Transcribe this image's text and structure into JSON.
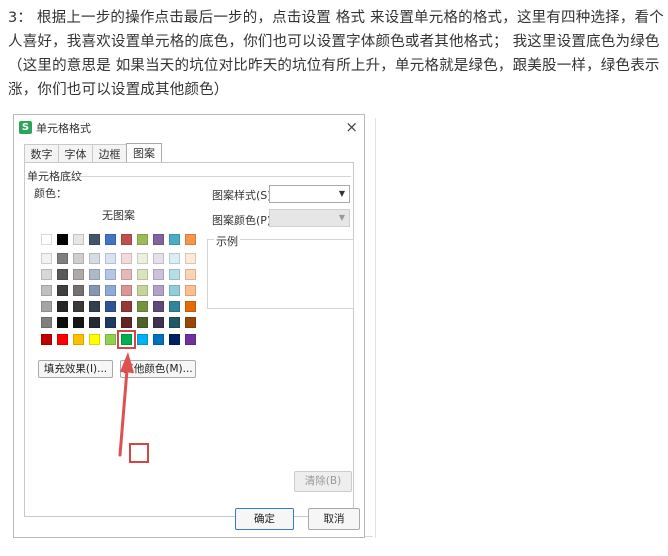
{
  "article": {
    "text": "3： 根据上一步的操作点击最后一步的，点击设置 格式 来设置单元格的格式，这里有四种选择，看个人喜好，我喜欢设置单元格的底色，你们也可以设置字体颜色或者其他格式；  我这里设置底色为绿色    （这里的意思是 如果当天的坑位对比昨天的坑位有所上升，单元格就是绿色，跟美股一样，绿色表示涨，你们也可以设置成其他颜色）"
  },
  "dialog": {
    "app_icon": "S",
    "title": "单元格格式",
    "close_icon": "×",
    "tabs": [
      "数字",
      "字体",
      "边框",
      "图案"
    ],
    "active_tab": "图案",
    "group_label": "单元格底纹",
    "color_label": "颜色：",
    "no_pattern": "无图案",
    "fill_effects_button": "填充效果(I)...",
    "more_colors_button": "其他颜色(M)...",
    "pattern_style_label": "图案样式(S):",
    "pattern_color_label": "图案颜色(P):",
    "sample_label": "示例",
    "clear_button": "清除(B)",
    "ok_button": "确定",
    "cancel_button": "取消",
    "selected_color": "#00a050"
  },
  "palette": {
    "row1": [
      "#ffffff",
      "#000000",
      "#e7e6e6",
      "#44546a",
      "#4472c4",
      "#c0504d",
      "#9bbb59",
      "#8064a2",
      "#4bacc6",
      "#f79646"
    ],
    "tints": [
      [
        "#f2f2f2",
        "#7f7f7f",
        "#d0cece",
        "#d6dce4",
        "#d9e2f3",
        "#f2dcdb",
        "#ebf1de",
        "#e5dfec",
        "#dbeef3",
        "#fde9d9"
      ],
      [
        "#d8d8d8",
        "#595959",
        "#aeaaaa",
        "#adb9ca",
        "#b4c6e7",
        "#e6b8b7",
        "#d7e4bc",
        "#ccc1d9",
        "#b7dde8",
        "#fbd4b4"
      ],
      [
        "#bfbfbf",
        "#3f3f3f",
        "#757070",
        "#8496b0",
        "#8eaadb",
        "#d99694",
        "#c3d69b",
        "#b2a2c7",
        "#92cddc",
        "#fac08f"
      ],
      [
        "#a5a5a5",
        "#262626",
        "#3a3838",
        "#323f4f",
        "#2f5496",
        "#953734",
        "#76923c",
        "#5f497a",
        "#31859b",
        "#e36c09"
      ],
      [
        "#7f7f7f",
        "#0c0c0c",
        "#171616",
        "#222a35",
        "#1f3864",
        "#632423",
        "#4f6128",
        "#3f3151",
        "#205867",
        "#974806"
      ]
    ],
    "standard": [
      "#c00000",
      "#ff0000",
      "#ffc000",
      "#ffff00",
      "#92d050",
      "#00b050",
      "#00b0f0",
      "#0070c0",
      "#002060",
      "#7030a0"
    ],
    "selected_index": 5
  }
}
